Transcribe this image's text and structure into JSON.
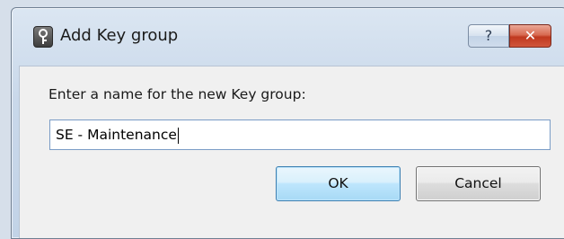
{
  "window": {
    "title": "Add Key group",
    "help_label": "?",
    "close_label": "✕"
  },
  "dialog": {
    "prompt": "Enter a name for the new Key group:",
    "name_value": "SE - Maintenance",
    "ok_label": "OK",
    "cancel_label": "Cancel"
  },
  "icons": {
    "app": "key-icon",
    "help": "help-icon",
    "close": "close-icon"
  },
  "colors": {
    "frame": "#c9d8ea",
    "client": "#f0f0f0",
    "close_button": "#c0391f",
    "default_button_border": "#3c7fb1"
  }
}
